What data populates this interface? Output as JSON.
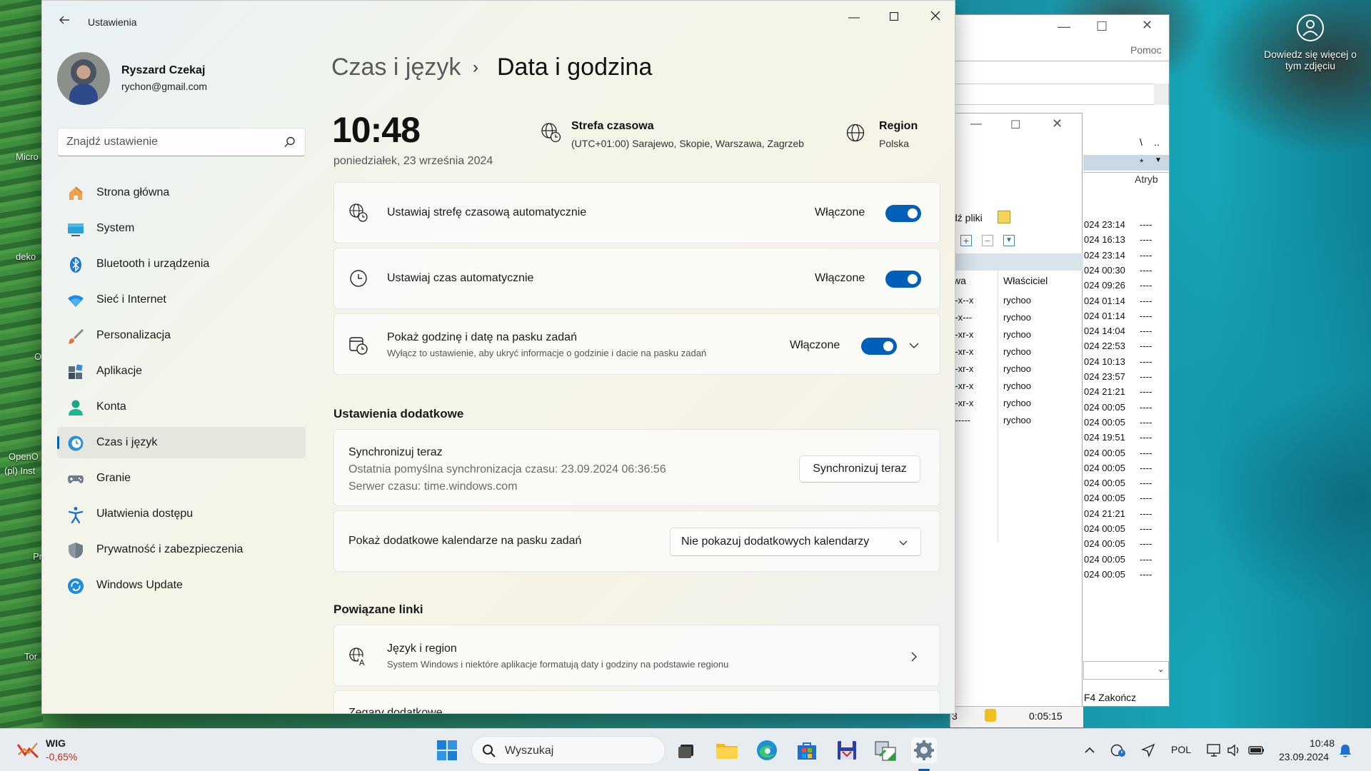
{
  "desktop": {
    "icons": [
      {
        "label": "Micro"
      },
      {
        "label": "deko"
      },
      {
        "label": "O"
      },
      {
        "label": "OpenO"
      },
      {
        "label": "(pl) Inst"
      },
      {
        "label": "Pr"
      },
      {
        "label": "Tor"
      }
    ],
    "photo_info": "Dowiedz się więcej o tym zdjęciu"
  },
  "background_window": {
    "menu_help": "Pomoc",
    "col_atrib": "Atryb",
    "find_files": "dź pliki",
    "col_perms": "wa",
    "col_owner": "Właściciel",
    "perm_rows": [
      {
        "perm": "--x--x",
        "owner": "rychoo"
      },
      {
        "perm": "r-x---",
        "owner": "rychoo"
      },
      {
        "perm": "r-xr-x",
        "owner": "rychoo"
      },
      {
        "perm": "r-xr-x",
        "owner": "rychoo"
      },
      {
        "perm": "r-xr-x",
        "owner": "rychoo"
      },
      {
        "perm": "r-xr-x",
        "owner": "rychoo"
      },
      {
        "perm": "r-xr-x",
        "owner": "rychoo"
      },
      {
        "perm": "r-----",
        "owner": "rychoo"
      }
    ],
    "dates": [
      "024 23:14",
      "024 16:13",
      "024 23:14",
      "024 00:30",
      "024 09:26",
      "024 01:14",
      "024 01:14",
      "024 14:04",
      "024 22:53",
      "024 10:13",
      "024 23:57",
      "024 21:21",
      "024 00:05",
      "024 00:05",
      "024 19:51",
      "024 00:05",
      "024 00:05",
      "024 00:05",
      "024 00:05",
      "024 21:21",
      "024 00:05",
      "024 00:05",
      "024 00:05",
      "024 00:05"
    ],
    "attr_value": "----",
    "path_sep": "\\",
    "path_dots": "..",
    "filter": "*",
    "footer": "F4 Zakończ",
    "status_time": "0:05:15",
    "status_left": "3"
  },
  "settings": {
    "app_title": "Ustawienia",
    "profile": {
      "name": "Ryszard Czekaj",
      "email": "rychon@gmail.com"
    },
    "search_placeholder": "Znajdź ustawienie",
    "nav": [
      {
        "label": "Strona główna",
        "icon": "home-icon"
      },
      {
        "label": "System",
        "icon": "system-icon"
      },
      {
        "label": "Bluetooth i urządzenia",
        "icon": "bluetooth-icon"
      },
      {
        "label": "Sieć i Internet",
        "icon": "wifi-icon"
      },
      {
        "label": "Personalizacja",
        "icon": "brush-icon"
      },
      {
        "label": "Aplikacje",
        "icon": "apps-icon"
      },
      {
        "label": "Konta",
        "icon": "account-icon"
      },
      {
        "label": "Czas i język",
        "icon": "time-language-icon",
        "selected": true
      },
      {
        "label": "Granie",
        "icon": "gamepad-icon"
      },
      {
        "label": "Ułatwienia dostępu",
        "icon": "accessibility-icon"
      },
      {
        "label": "Prywatność i zabezpieczenia",
        "icon": "shield-icon"
      },
      {
        "label": "Windows Update",
        "icon": "update-icon"
      }
    ],
    "breadcrumb": {
      "parent": "Czas i język",
      "separator": "›",
      "current": "Data i godzina"
    },
    "clock": {
      "time": "10:48",
      "date": "poniedziałek, 23 września 2024"
    },
    "timezone": {
      "title": "Strefa czasowa",
      "value": "(UTC+01:00) Sarajewo, Skopie, Warszawa, Zagrzeb"
    },
    "region": {
      "title": "Region",
      "value": "Polska"
    },
    "toggles": [
      {
        "label": "Ustawiaj strefę czasową automatycznie",
        "state": "Włączone",
        "on": true
      },
      {
        "label": "Ustawiaj czas automatycznie",
        "state": "Włączone",
        "on": true
      },
      {
        "label": "Pokaż godzinę i datę na pasku zadań",
        "sub": "Wyłącz to ustawienie, aby ukryć informacje o godzinie i dacie na pasku zadań",
        "state": "Włączone",
        "on": true
      }
    ],
    "additional": {
      "heading": "Ustawienia dodatkowe",
      "sync_title": "Synchronizuj teraz",
      "sync_last": "Ostatnia pomyślna synchronizacja czasu: 23.09.2024 06:36:56",
      "sync_server": "Serwer czasu: time.windows.com",
      "sync_button": "Synchronizuj teraz",
      "calendars_label": "Pokaż dodatkowe kalendarze na pasku zadań",
      "calendars_value": "Nie pokazuj dodatkowych kalendarzy"
    },
    "related": {
      "heading": "Powiązane linki",
      "lang_title": "Język i region",
      "lang_sub": "System Windows i niektóre aplikacje formatują daty i godziny na podstawie regionu",
      "clocks_title": "Zegary dodatkowe"
    }
  },
  "taskbar": {
    "stock_name": "WIG",
    "stock_change": "-0,65%",
    "search_label": "Wyszukaj",
    "lang": "POL",
    "time": "10:48",
    "date": "23.09.2024"
  }
}
